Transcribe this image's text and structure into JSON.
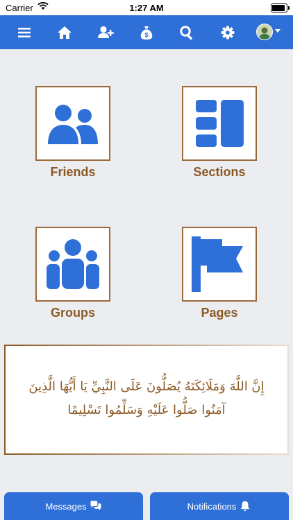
{
  "status": {
    "carrier": "Carrier",
    "time": "1:27 AM"
  },
  "nav": {
    "icons": [
      "menu-icon",
      "home-icon",
      "add-user-icon",
      "money-bag-icon",
      "search-icon",
      "gear-icon",
      "avatar",
      "chevron-down-icon"
    ]
  },
  "tiles": [
    {
      "label": "Friends",
      "icon": "friends-icon"
    },
    {
      "label": "Sections",
      "icon": "sections-icon"
    },
    {
      "label": "Groups",
      "icon": "groups-icon"
    },
    {
      "label": "Pages",
      "icon": "flag-icon"
    }
  ],
  "verse": {
    "line1": "إِنَّ اللَّهَ وَمَلَائِكَتَهُ يُصَلُّونَ عَلَى النَّبِيِّ يَا أَيُّهَا الَّذِينَ",
    "line2": "آمَنُوا صَلُّوا عَلَيْهِ وَسَلِّمُوا تَسْلِيمًا"
  },
  "bottom": {
    "messages_label": "Messages",
    "notifications_label": "Notifications"
  },
  "colors": {
    "primary": "#2e6fd8",
    "label": "#8a5a25",
    "tile_border": "#9a6a3a",
    "background": "#ecedf1"
  }
}
